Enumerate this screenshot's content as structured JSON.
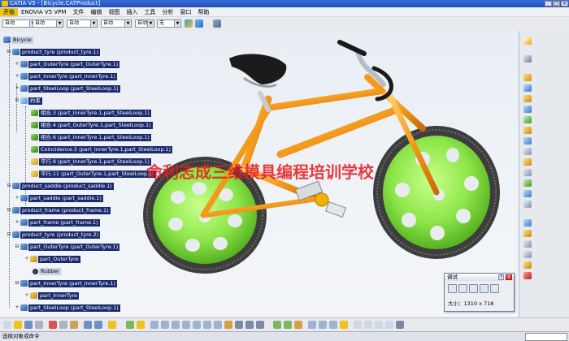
{
  "window": {
    "title": "CATIA V5 - [Bicycle.CATProduct]"
  },
  "menu": [
    {
      "label": "开始",
      "active": true
    },
    {
      "label": "ENOVIA V5 VPM"
    },
    {
      "label": "文件"
    },
    {
      "label": "编辑"
    },
    {
      "label": "视图"
    },
    {
      "label": "插入"
    },
    {
      "label": "工具"
    },
    {
      "label": "分析"
    },
    {
      "label": "窗口"
    },
    {
      "label": "帮助"
    }
  ],
  "toolbar": {
    "combo1": "自动",
    "combo2": "自动",
    "combo3": "自动",
    "combo4": "自动",
    "combo5": "自动",
    "combo6": "无"
  },
  "tree": [
    {
      "label": "Bicycle",
      "style": "light"
    },
    {
      "label": "product_tyre (product_tyre.1)"
    },
    {
      "label": "part_OuterTyre (part_OuterTyre.1)"
    },
    {
      "label": "part_InnerTyre (part_InnerTyre.1)"
    },
    {
      "label": "part_SteelLoop (part_SteelLoop.1)"
    },
    {
      "label": "约束"
    },
    {
      "label": "相合.3 (part_InnerTyre.1,part_SteelLoop.1)"
    },
    {
      "label": "相合.4 (part_OuterTyre.1,part_SteelLoop.1)"
    },
    {
      "label": "相合.6 (part_InnerTyre.1,part_SteelLoop.1)"
    },
    {
      "label": "Coincidence.5 (part_InnerTyre.1,part_SteelLoop.1)"
    },
    {
      "label": "平行.9 (part_InnerTyre.1,part_SteelLoop.1)"
    },
    {
      "label": "平行.11 (part_OuterTyre.1,part_SteelLoop.1)"
    },
    {
      "label": "product_saddle (product_saddle.1)"
    },
    {
      "label": "part_saddle (part_saddle.1)"
    },
    {
      "label": "product_frame (product_frame.1)"
    },
    {
      "label": "part_frame (part_frame.1)"
    },
    {
      "label": "product_tyre (product_tyre.2)"
    },
    {
      "label": "part_OuterTyre (part_OuterTyre.1)"
    },
    {
      "label": "part_OuterTyre"
    },
    {
      "label": "Rubber",
      "style": "light"
    },
    {
      "label": "part_InnerTyre (part_InnerTyre.1)"
    },
    {
      "label": "part_InnerTyre"
    },
    {
      "label": "part_SteelLoop (part_SteelLoop.1)"
    }
  ],
  "watermark": "命利志成三维模具编程培训学校",
  "dialog": {
    "title": "调试",
    "size_label": "大小：1310 x 718"
  },
  "status": {
    "message": "选择对象或命令"
  },
  "colors": {
    "accent": "#f1c21b",
    "tree_label_bg": "#1a2a6c",
    "frame": "#f39a1c",
    "wheel": "#8ee64a",
    "tire": "#4a4a4a",
    "watermark": "#e8191b"
  }
}
